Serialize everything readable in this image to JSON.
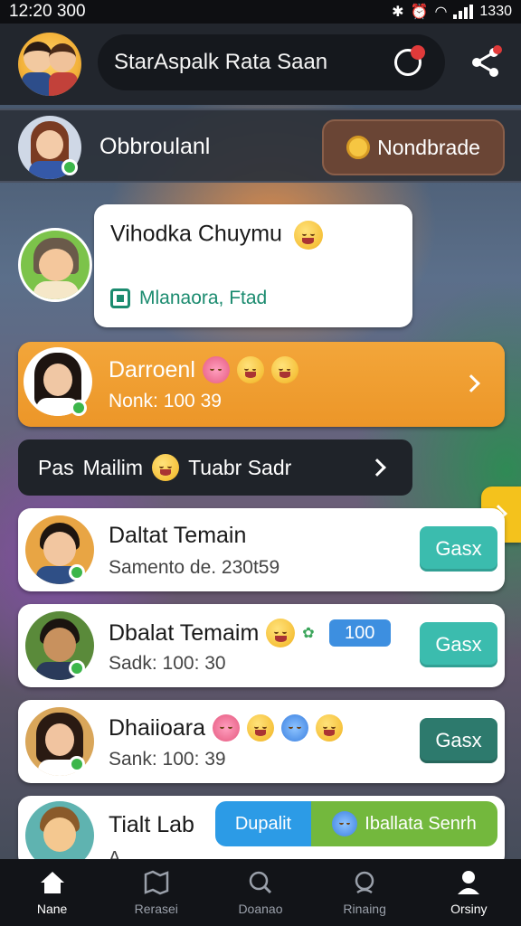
{
  "status_bar": {
    "time": "12:20 300",
    "battery": "1330"
  },
  "header": {
    "title": "StarAspalk Rata Saan",
    "chat_badge": "",
    "share_badge": ""
  },
  "profile": {
    "name": "Obbroulanl",
    "action_label": "Nondbrade"
  },
  "bubble": {
    "title": "Vihodka Chuymu",
    "subtitle": "Mlanaora, Ftad"
  },
  "featured": {
    "name": "Darroenl",
    "meta": "Nonk: 100 39"
  },
  "pass_bar": {
    "left": "Pas",
    "middle": "Mailim",
    "right": "Tuabr Sadr"
  },
  "rows": [
    {
      "name": "Daltat Temain",
      "meta": "Samento de. 230t59",
      "button": "Gasx"
    },
    {
      "name": "Dbalat Temaim",
      "meta": "Sadk: 100: 30",
      "badge": "100",
      "button": "Gasx"
    },
    {
      "name": "Dhaiioara",
      "meta": "Sank: 100: 39",
      "button": "Gasx"
    }
  ],
  "last_row": {
    "name": "Tialt Lab",
    "meta": "A...",
    "split_left": "Dupalit",
    "split_right": "Iballata Senrh"
  },
  "nav": [
    {
      "label": "Nane",
      "icon": "home-icon"
    },
    {
      "label": "Rerasei",
      "icon": "map-icon"
    },
    {
      "label": "Doanao",
      "icon": "search-icon"
    },
    {
      "label": "Rinaing",
      "icon": "ring-icon"
    },
    {
      "label": "Orsiny",
      "icon": "profile-icon"
    }
  ],
  "colors": {
    "orange": "#ec9628",
    "teal": "#3bbcae",
    "blue": "#2c9be6",
    "green": "#73b83d",
    "brown": "#6a4535"
  }
}
